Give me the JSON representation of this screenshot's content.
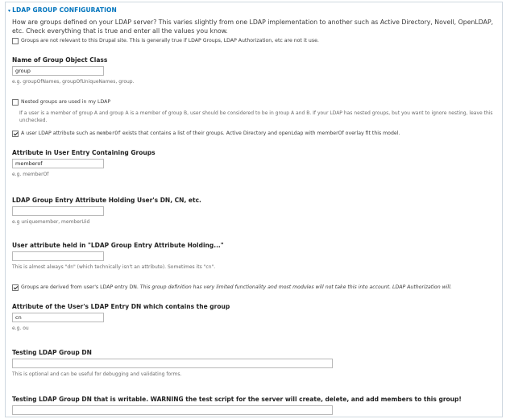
{
  "fieldset": {
    "title": "LDAP GROUP CONFIGURATION"
  },
  "intro": "How are groups defined on your LDAP server? This varies slightly from one LDAP implementation to another such as Active Directory, Novell, OpenLDAP, etc. Check everything that is true and enter all the values you know.",
  "groups_not_relevant": {
    "label": "Groups are not relevant to this Drupal site. This is generally true if LDAP Groups, LDAP Authorization, etc are not it use.",
    "checked": false
  },
  "group_object_class": {
    "label": "Name of Group Object Class",
    "value": "group",
    "description": "e.g. groupOfNames, groupOfUniqueNames, group."
  },
  "nested": {
    "label": "Nested groups are used in my LDAP",
    "checked": false,
    "description": "If a user is a member of group A and group A is a member of group B, user should be considered to be in group A and B. If your LDAP has nested groups, but you want to ignore nesting, leave this unchecked."
  },
  "memberof_attr_exists": {
    "label_pre": "A user LDAP attribute such as ",
    "label_code": "memberOf",
    "label_post": " exists that contains a list of their groups. Active Directory and openLdap with memberOf overlay fit this model.",
    "checked": true
  },
  "user_attr": {
    "label": "Attribute in User Entry Containing Groups",
    "value": "memberof",
    "description": "e.g. memberOf"
  },
  "group_entry_attr": {
    "label": "LDAP Group Entry Attribute Holding User's DN, CN, etc.",
    "value": "",
    "description": "e.g uniquemember, memberUid"
  },
  "user_attr_held": {
    "label": "User attribute held in \"LDAP Group Entry Attribute Holding...\"",
    "value": "",
    "description": "This is almost always \"dn\" (which technically isn't an attribute). Sometimes its \"cn\"."
  },
  "derived_from_dn": {
    "label_pre": "Groups are derived from user's LDAP entry DN.",
    "label_italic": " This group definition has very limited functionality and most modules will not take this into account. LDAP Authorization will.",
    "checked": true
  },
  "dn_attr": {
    "label": "Attribute of the User's LDAP Entry DN which contains the group",
    "value": "cn",
    "description": "e.g. ou"
  },
  "test_group_dn": {
    "label": "Testing LDAP Group DN",
    "value": "",
    "description": "This is optional and can be useful for debugging and validating forms."
  },
  "test_group_dn_writable": {
    "label": "Testing LDAP Group DN that is writable. WARNING the test script for the server will create, delete, and add members to this group!",
    "value": ""
  }
}
